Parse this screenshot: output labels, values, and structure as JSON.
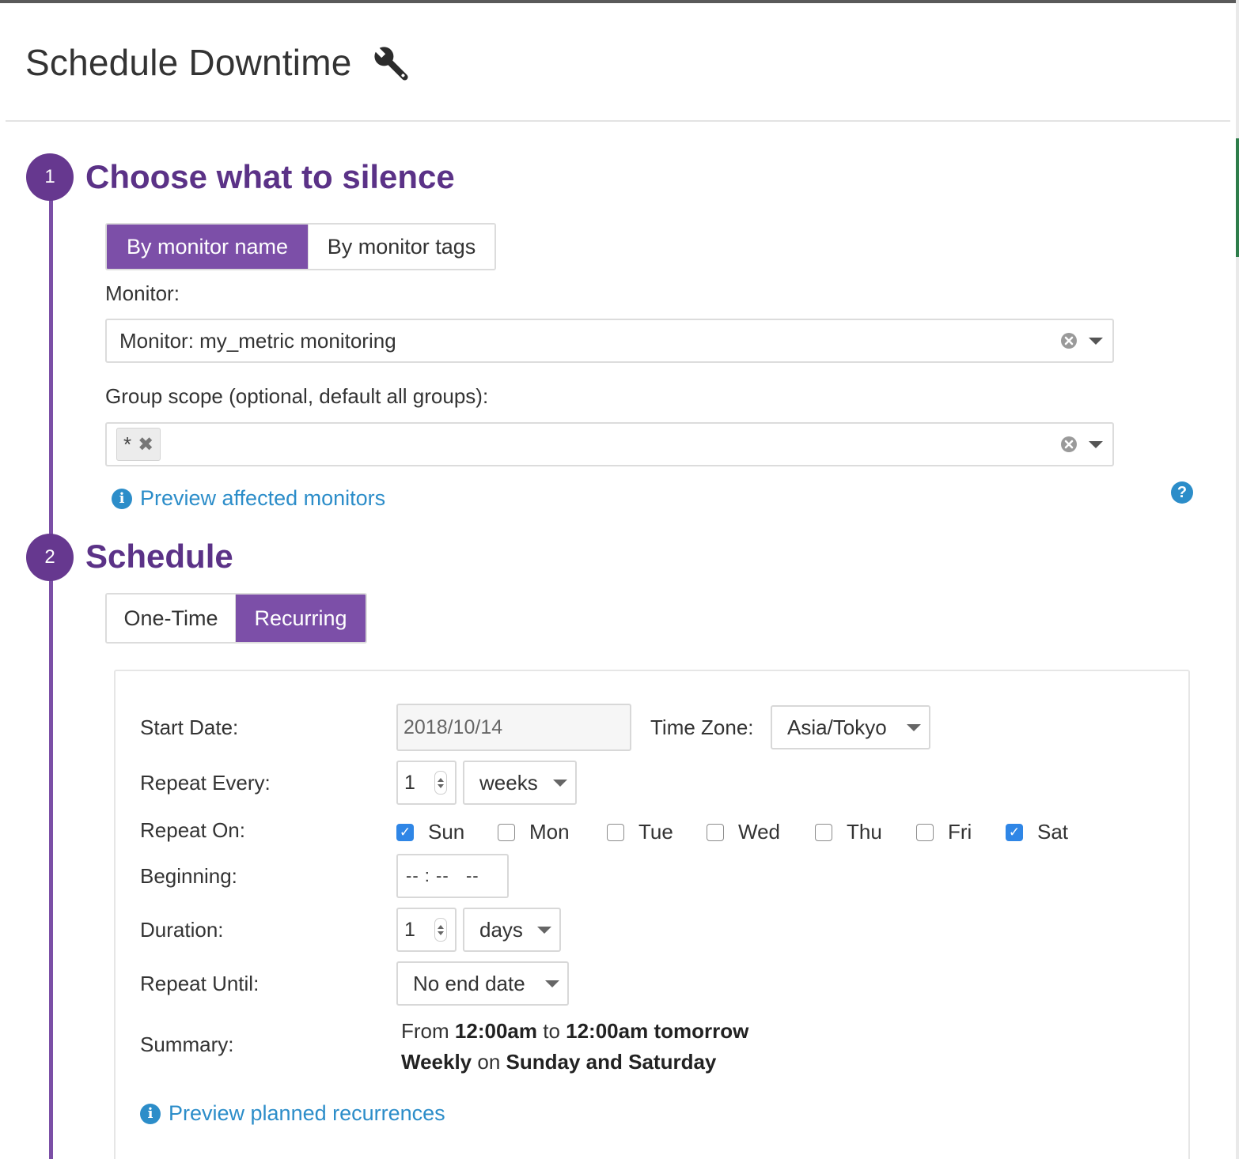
{
  "header": {
    "title": "Schedule Downtime",
    "icon": "wrench-icon"
  },
  "steps": [
    {
      "number": "1",
      "title": "Choose what to silence"
    },
    {
      "number": "2",
      "title": "Schedule"
    }
  ],
  "silence": {
    "tabs": [
      {
        "label": "By monitor name",
        "active": true
      },
      {
        "label": "By monitor tags",
        "active": false
      }
    ],
    "monitor_label": "Monitor:",
    "monitor_value": "Monitor: my_metric monitoring",
    "group_scope_label": "Group scope (optional, default all groups):",
    "group_scope_chip": "*",
    "preview_link": "Preview affected monitors",
    "help_glyph": "?"
  },
  "schedule": {
    "tabs": [
      {
        "label": "One-Time",
        "active": false
      },
      {
        "label": "Recurring",
        "active": true
      }
    ],
    "start_date_label": "Start Date:",
    "start_date_value": "2018/10/14",
    "time_zone_label": "Time Zone:",
    "time_zone_value": "Asia/Tokyo",
    "repeat_every_label": "Repeat Every:",
    "repeat_every_value": "1",
    "repeat_every_unit": "weeks",
    "repeat_on_label": "Repeat On:",
    "days": [
      {
        "label": "Sun",
        "checked": true
      },
      {
        "label": "Mon",
        "checked": false
      },
      {
        "label": "Tue",
        "checked": false
      },
      {
        "label": "Wed",
        "checked": false
      },
      {
        "label": "Thu",
        "checked": false
      },
      {
        "label": "Fri",
        "checked": false
      },
      {
        "label": "Sat",
        "checked": true
      }
    ],
    "beginning_label": "Beginning:",
    "beginning_value": "-- : --   --",
    "duration_label": "Duration:",
    "duration_value": "1",
    "duration_unit": "days",
    "repeat_until_label": "Repeat Until:",
    "repeat_until_value": "No end date",
    "summary_label": "Summary:",
    "summary_line1": {
      "from": "From",
      "start": "12:00am",
      "to": "to",
      "end": "12:00am tomorrow"
    },
    "summary_line2": {
      "freq": "Weekly",
      "on": "on",
      "days": "Sunday and Saturday"
    },
    "preview_link": "Preview planned recurrences"
  },
  "colors": {
    "brand_purple": "#66388f",
    "active_tab": "#7c4fa8",
    "link_blue": "#2c8dc9",
    "checkbox_blue": "#2f86e6"
  }
}
